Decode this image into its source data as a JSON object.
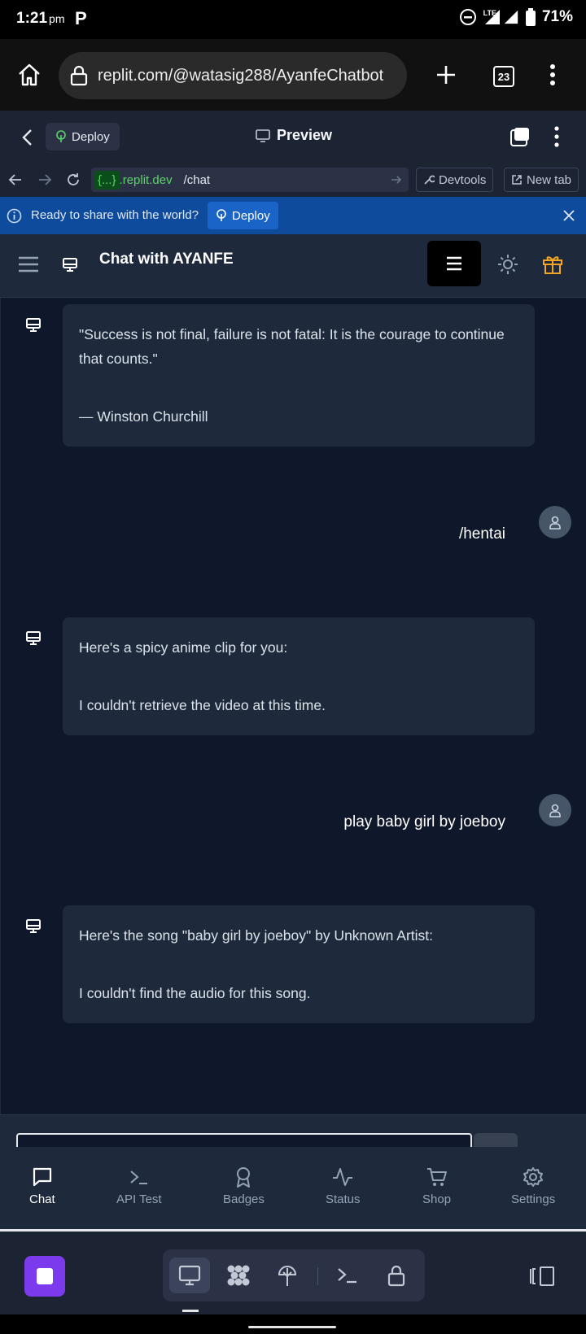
{
  "status_bar": {
    "time": "1:21",
    "ampm": "pm",
    "network": "LTE",
    "battery": "71%"
  },
  "browser": {
    "url": "replit.com/@watasig288/AyanfeChatbot",
    "tab_count": "23"
  },
  "replit_bar": {
    "deploy_label": "Deploy",
    "preview_label": "Preview"
  },
  "devtools_bar": {
    "domain_chip": "{...}",
    "domain_rest": ".replit.dev",
    "path": "/chat",
    "devtools_label": "Devtools",
    "new_tab_label": "New tab"
  },
  "banner": {
    "text": "Ready to share with the world?",
    "deploy_label": "Deploy"
  },
  "app": {
    "title": "Chat with AYANFE"
  },
  "messages": [
    {
      "role": "bot",
      "lines": [
        "\"Success is not final, failure is not fatal: It is the courage to continue that counts.\"",
        "— Winston Churchill"
      ]
    },
    {
      "role": "user",
      "text": "/hentai"
    },
    {
      "role": "bot",
      "lines": [
        "Here's a spicy anime clip for you:",
        "I couldn't retrieve the video at this time."
      ]
    },
    {
      "role": "user",
      "text": "play baby girl by joeboy"
    },
    {
      "role": "bot",
      "lines": [
        "Here's the song \"baby girl by joeboy\" by Unknown Artist:",
        "I couldn't find the audio for this song."
      ]
    }
  ],
  "nav": {
    "items": [
      {
        "label": "Chat",
        "icon": "chat-bubble-icon",
        "active": true
      },
      {
        "label": "API Test",
        "icon": "terminal-icon"
      },
      {
        "label": "Badges",
        "icon": "badge-icon"
      },
      {
        "label": "Status",
        "icon": "pulse-icon"
      },
      {
        "label": "Shop",
        "icon": "cart-icon"
      },
      {
        "label": "Settings",
        "icon": "gear-icon"
      }
    ]
  },
  "colors": {
    "app_bg": "#0f172a",
    "panel": "#1e293b",
    "replit_bg": "#1c2333",
    "banner": "#0f4b9c",
    "accent_gift": "#f5a524",
    "stop_purple": "#7c3aed"
  }
}
